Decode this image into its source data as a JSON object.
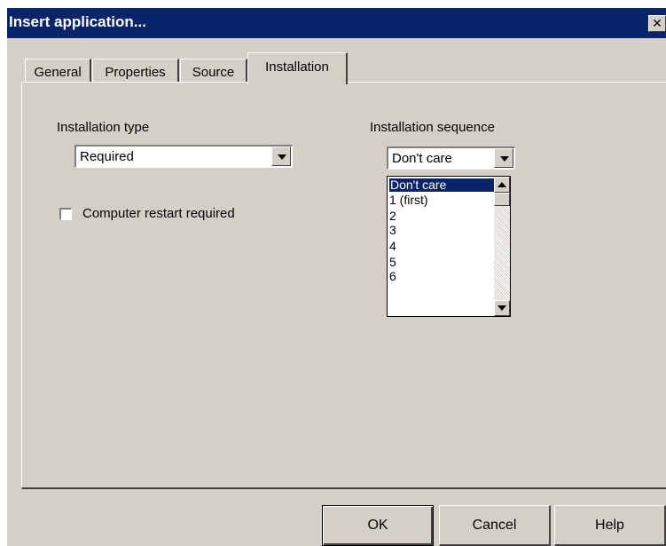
{
  "window": {
    "title": "Insert application...",
    "close_glyph": "✕"
  },
  "tabs": [
    {
      "label": "General"
    },
    {
      "label": "Properties"
    },
    {
      "label": "Source"
    },
    {
      "label": "Installation",
      "active": true
    }
  ],
  "installation_type": {
    "label": "Installation type",
    "selected": "Required"
  },
  "restart": {
    "label": "Computer restart required",
    "checked": false
  },
  "installation_sequence": {
    "label": "Installation sequence",
    "selected": "Don't care",
    "options": [
      "Don't care",
      "1 (first)",
      "2",
      "3",
      "4",
      "5",
      "6"
    ],
    "highlighted_index": 0
  },
  "buttons": {
    "ok": "OK",
    "cancel": "Cancel",
    "help": "Help"
  },
  "colors": {
    "titlebar": "#0a246a",
    "face": "#d4d0c8",
    "selection": "#0a246a"
  }
}
